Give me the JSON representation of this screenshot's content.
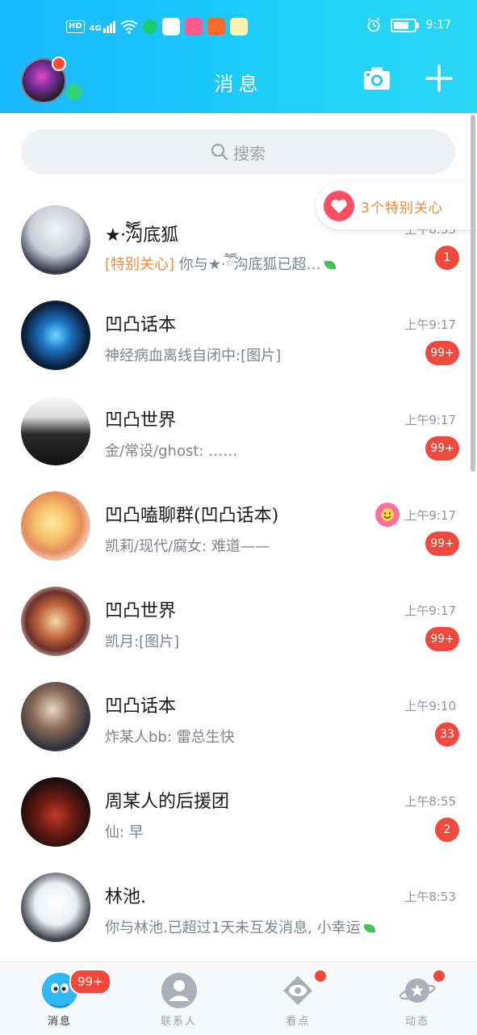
{
  "status_bar": {
    "network": "HD",
    "signal": "4G",
    "time": "9:17"
  },
  "header": {
    "title": "消息"
  },
  "search": {
    "placeholder": "搜索"
  },
  "special_care": {
    "label": "3个特别关心"
  },
  "conversations": [
    {
      "name": "★·ཽ沟底狐",
      "tag": "[特别关心]",
      "message": " 你与★·ཽ沟底狐已超…",
      "time": "上午8:53",
      "badge": "1"
    },
    {
      "name": "凹凸话本",
      "tag": "",
      "message": "神经病血离线自闭中:[图片]",
      "time": "上午9:17",
      "badge": "99+"
    },
    {
      "name": "凹凸世界",
      "tag": "",
      "message": "金/常设/ghost: ……",
      "time": "上午9:17",
      "badge": "99+"
    },
    {
      "name": "凹凸嗑聊群(凹凸话本)",
      "tag": "",
      "message": "凯莉/现代/腐女: 难道——",
      "time": "上午9:17",
      "badge": "99+"
    },
    {
      "name": "凹凸世界",
      "tag": "",
      "message": "凯月:[图片]",
      "time": "上午9:17",
      "badge": "99+"
    },
    {
      "name": "凹凸话本",
      "tag": "",
      "message": "炸某人bb: 雷总生快",
      "time": "上午9:10",
      "badge": "33"
    },
    {
      "name": "周某人的后援团",
      "tag": "",
      "message": "仙: 早",
      "time": "上午8:55",
      "badge": "2"
    },
    {
      "name": "林池.",
      "tag": "",
      "message": "你与林池.已超过1天未互发消息, 小幸运",
      "time": "上午8:53",
      "badge": ""
    }
  ],
  "bottom_nav": {
    "items": [
      {
        "label": "消息",
        "badge": "99+"
      },
      {
        "label": "联系人"
      },
      {
        "label": "看点"
      },
      {
        "label": "动态"
      }
    ]
  },
  "colors": {
    "header_start": "#19b8ff",
    "header_end": "#2ad7f4",
    "badge": "#f2493d",
    "special_care": "#f08a3c",
    "online": "#32d27a"
  }
}
